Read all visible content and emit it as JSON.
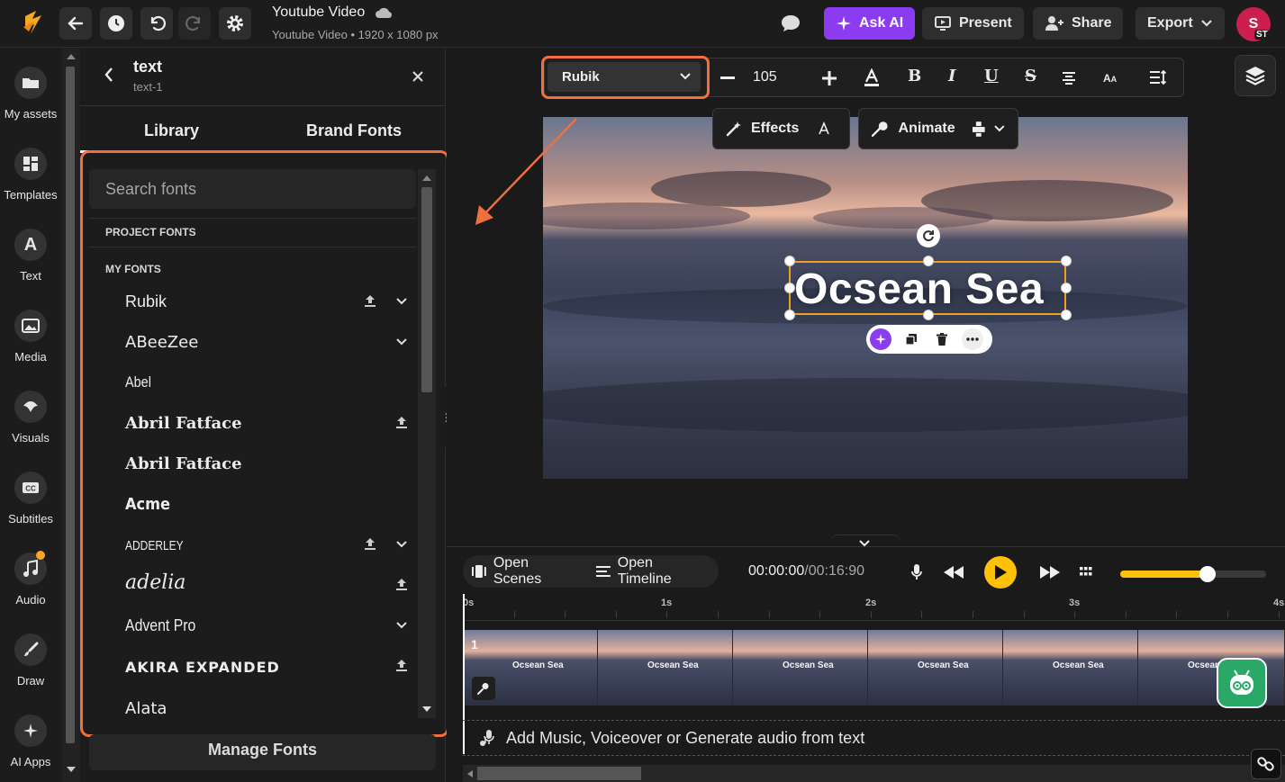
{
  "header": {
    "doc_title": "Youtube Video",
    "doc_subtitle": "Youtube Video • 1920 x 1080 px",
    "ask_ai": "Ask AI",
    "present": "Present",
    "share": "Share",
    "export": "Export",
    "avatar_initial": "S",
    "avatar_tag": "ST"
  },
  "rail": {
    "items": [
      {
        "label": "My assets",
        "icon": "folder-icon"
      },
      {
        "label": "Templates",
        "icon": "grid-icon"
      },
      {
        "label": "Text",
        "icon": "letter-a-icon"
      },
      {
        "label": "Media",
        "icon": "image-icon"
      },
      {
        "label": "Visuals",
        "icon": "shapes-icon"
      },
      {
        "label": "Subtitles",
        "icon": "cc-icon"
      },
      {
        "label": "Audio",
        "icon": "music-note-icon"
      },
      {
        "label": "Draw",
        "icon": "brush-icon"
      },
      {
        "label": "AI Apps",
        "icon": "sparkle-icon"
      }
    ]
  },
  "panel": {
    "title": "text",
    "subtitle": "text-1",
    "tabs": [
      "Library",
      "Brand Fonts"
    ],
    "search_placeholder": "Search fonts",
    "section_project": "PROJECT FONTS",
    "section_my": "MY FONTS",
    "fonts": [
      {
        "name": "Rubik",
        "upload": true,
        "expand": true
      },
      {
        "name": "ABeeZee",
        "upload": false,
        "expand": true
      },
      {
        "name": "Abel",
        "upload": false,
        "expand": false
      },
      {
        "name": "Abril Fatface",
        "upload": true,
        "expand": false
      },
      {
        "name": "Abril Fatface",
        "upload": false,
        "expand": false
      },
      {
        "name": "Acme",
        "upload": false,
        "expand": false
      },
      {
        "name": "ADDERLEY",
        "upload": true,
        "expand": true
      },
      {
        "name": "adelia",
        "upload": true,
        "expand": false
      },
      {
        "name": "Advent Pro",
        "upload": false,
        "expand": true
      },
      {
        "name": "AKIRA EXPANDED",
        "upload": true,
        "expand": false
      },
      {
        "name": "Alata",
        "upload": false,
        "expand": false
      }
    ],
    "manage_fonts": "Manage Fonts"
  },
  "text_toolbar": {
    "font": "Rubik",
    "size": "105",
    "effects": "Effects",
    "animate": "Animate"
  },
  "canvas": {
    "text": "Ocsean Sea"
  },
  "timeline": {
    "open_scenes": "Open Scenes",
    "open_timeline": "Open Timeline",
    "current_time": "00:00:00",
    "total_time": "/00:16:90",
    "ruler": [
      "0s",
      "1s",
      "2s",
      "3s",
      "4s"
    ],
    "scene_number": "1",
    "thumb_text": "Ocsean Sea",
    "add_audio": "Add Music, Voiceover or Generate audio from text",
    "zoom_fraction": 0.6
  },
  "colors": {
    "accent_orange": "#f06f3e",
    "ai_purple": "#8c3cf0",
    "play_yellow": "#ffc107",
    "selection": "#f0a020"
  }
}
